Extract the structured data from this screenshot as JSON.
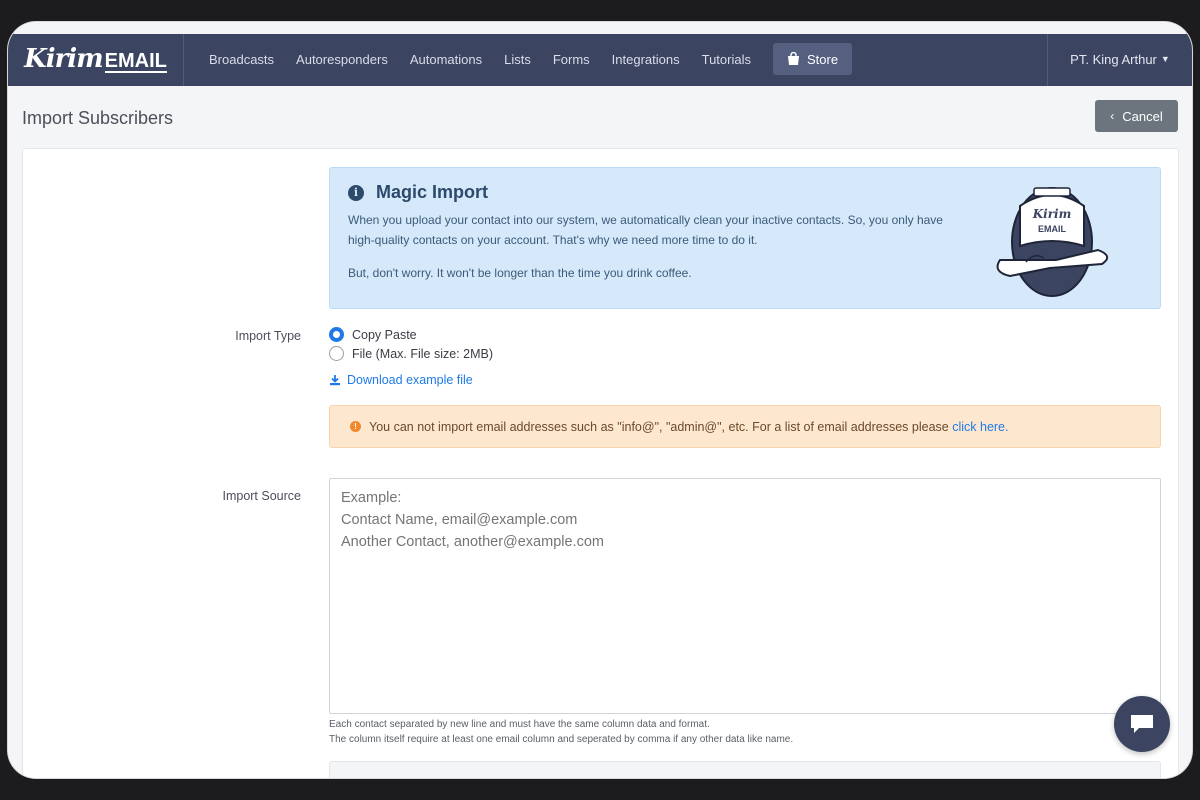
{
  "brand": {
    "logo_script": "Kirim",
    "logo_word": "EMAIL"
  },
  "nav": {
    "items": [
      "Broadcasts",
      "Autoresponders",
      "Automations",
      "Lists",
      "Forms",
      "Integrations",
      "Tutorials"
    ],
    "store_label": "Store",
    "user_label": "PT. King Arthur"
  },
  "page": {
    "title": "Import Subscribers",
    "cancel_label": "Cancel"
  },
  "info": {
    "title": "Magic Import",
    "para1": "When you upload your contact into our system, we automatically clean your inactive contacts. So, you only have high-quality contacts on your account. That's why we need more time to do it.",
    "para2": "But, don't worry. It won't be longer than the time you drink coffee.",
    "mascot_label": "EMAIL",
    "mascot_script": "Kirim"
  },
  "form": {
    "import_type_label": "Import Type",
    "options": [
      {
        "label": "Copy Paste",
        "checked": true
      },
      {
        "label": "File (Max. File size: 2MB)",
        "checked": false
      }
    ],
    "download_label": "Download example file",
    "warning_text": "You can not import email addresses such as \"info@\", \"admin@\", etc. For a list of email addresses please ",
    "warning_link": "click here.",
    "import_source_label": "Import Source",
    "textarea_placeholder": "Example:\nContact Name, email@example.com\nAnother Contact, another@example.com",
    "help1": "Each contact separated by new line and must have the same column data and format.",
    "help2": "The column itself require at least one email column and seperated by comma if any other data like name."
  },
  "colors": {
    "nav_bg": "#3b4461",
    "accent": "#1f7ae8",
    "info_bg": "#d6e9fa",
    "warn_bg": "#fde7cf"
  }
}
